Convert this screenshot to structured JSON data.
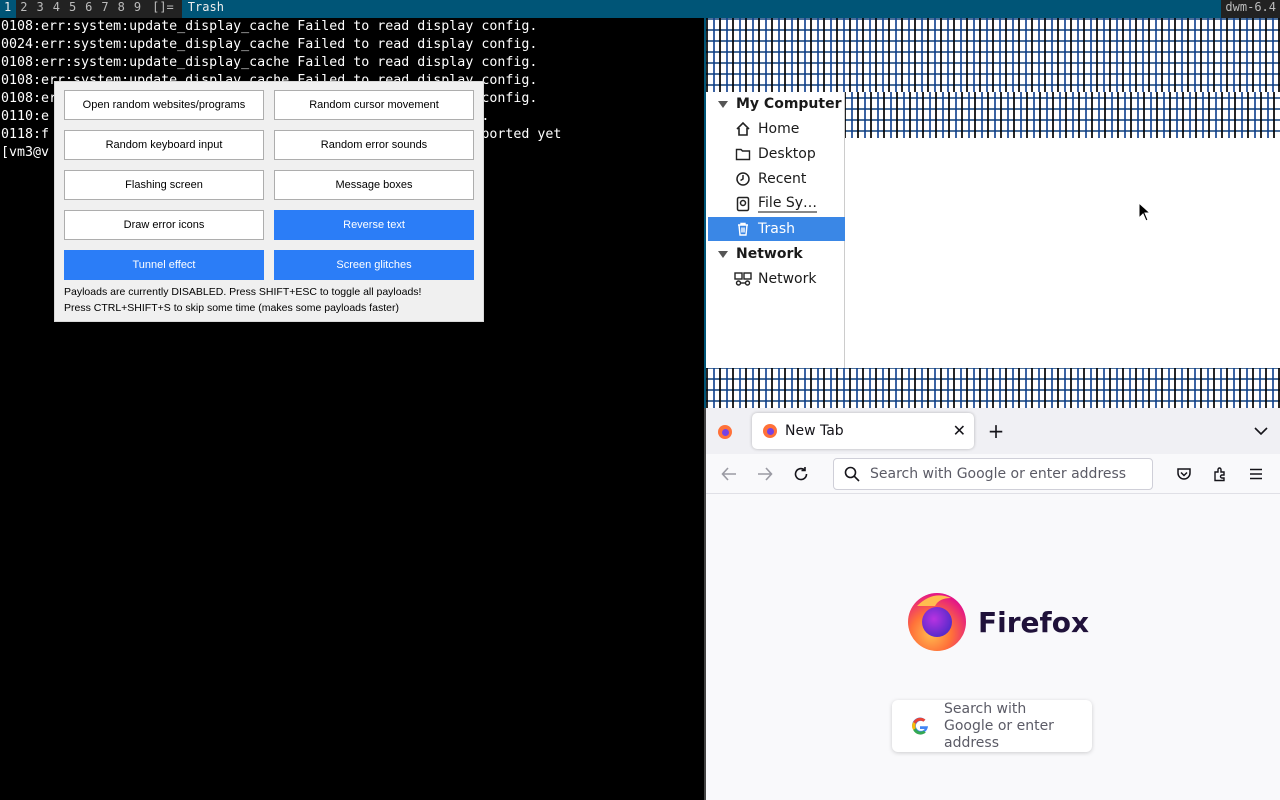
{
  "bar": {
    "tags": [
      "1",
      "2",
      "3",
      "4",
      "5",
      "6",
      "7",
      "8",
      "9"
    ],
    "layout": "[]=",
    "window_title": "Trash",
    "status": "dwm-6.4"
  },
  "terminal": {
    "lines": [
      "0108:err:system:update_display_cache Failed to read display config.",
      "0024:err:system:update_display_cache Failed to read display config.",
      "0108:err:system:update_display_cache Failed to read display config.",
      "0108:err:system:update_display_cache Failed to read display config.",
      "0108:err:system:update_display_cache Failed to read display config.",
      "0110:e                                                  so.1.",
      "0118:f                                                   supported yet",
      "[vm3@v"
    ]
  },
  "dialog": {
    "buttons": [
      {
        "label": "Open random websites/programs",
        "active": false
      },
      {
        "label": "Random cursor movement",
        "active": false
      },
      {
        "label": "Random keyboard input",
        "active": false
      },
      {
        "label": "Random error sounds",
        "active": false
      },
      {
        "label": "Flashing screen",
        "active": false
      },
      {
        "label": "Message boxes",
        "active": false
      },
      {
        "label": "Draw error icons",
        "active": false
      },
      {
        "label": "Reverse text",
        "active": true
      },
      {
        "label": "Tunnel effect",
        "active": true
      },
      {
        "label": "Screen glitches",
        "active": true
      }
    ],
    "note1": "Payloads are currently DISABLED. Press SHIFT+ESC to toggle all payloads!",
    "note2": "Press CTRL+SHIFT+S to skip some time (makes some payloads faster)"
  },
  "file_manager": {
    "sections": [
      {
        "label": "My Computer",
        "items": [
          {
            "label": "Home",
            "icon": "home-icon"
          },
          {
            "label": "Desktop",
            "icon": "folder-icon"
          },
          {
            "label": "Recent",
            "icon": "clock-icon"
          },
          {
            "label": "File Sy…",
            "icon": "drive-icon"
          },
          {
            "label": "Trash",
            "icon": "trash-icon",
            "selected": true
          }
        ]
      },
      {
        "label": "Network",
        "items": [
          {
            "label": "Network",
            "icon": "network-icon"
          }
        ]
      }
    ]
  },
  "firefox": {
    "tab_title": "New Tab",
    "url_placeholder": "Search with Google or enter address",
    "brand": "Firefox",
    "search_text": "Search with Google or enter address",
    "accent": "#2b7df7"
  }
}
